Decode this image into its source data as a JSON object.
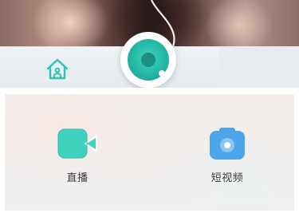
{
  "colors": {
    "accent": "#2ec4b0",
    "camera_blue": "#4da6ea",
    "label_text": "#3b3b3b"
  },
  "tabbar": {
    "home_icon": "home-icon",
    "center_icon": "record-disc-icon"
  },
  "sheet": {
    "options": [
      {
        "icon": "video-camera-icon",
        "label": "直播"
      },
      {
        "icon": "photo-camera-icon",
        "label": "短视频"
      }
    ]
  }
}
